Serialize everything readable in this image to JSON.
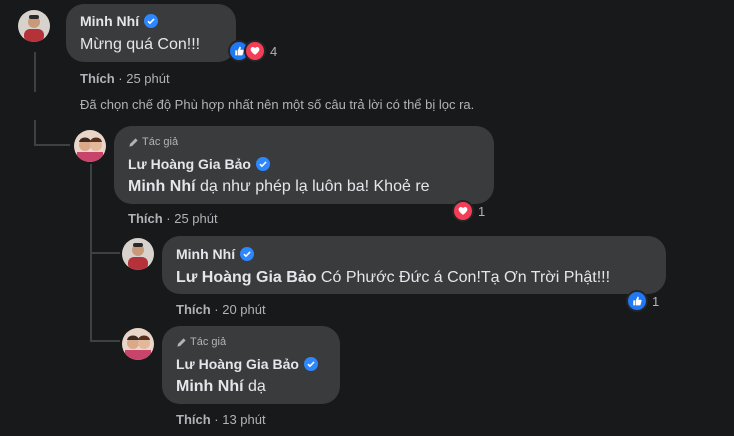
{
  "notice": "Đã chọn chế độ Phù hợp nhất nên một số câu trả lời có thể bị lọc ra.",
  "comments": [
    {
      "author": "Minh Nhí",
      "text": "Mừng quá Con!!!",
      "like_label": "Thích",
      "time": "· 25 phút",
      "reactions": [
        "like",
        "love"
      ],
      "reaction_count": "4"
    },
    {
      "badge": "Tác giả",
      "author": "Lư Hoàng Gia Bảo",
      "mention": "Minh Nhí",
      "text": " dạ như phép lạ luôn ba! Khoẻ re",
      "like_label": "Thích",
      "time": "· 25 phút",
      "reactions": [
        "love"
      ],
      "reaction_count": "1"
    },
    {
      "author": "Minh Nhí",
      "mention": "Lư Hoàng Gia Bảo",
      "text": " Có Phước Đức á Con!Tạ Ơn Trời Phật!!!",
      "like_label": "Thích",
      "time": "· 20 phút",
      "reactions": [
        "like"
      ],
      "reaction_count": "1"
    },
    {
      "badge": "Tác giả",
      "author": "Lư Hoàng Gia Bảo",
      "mention": "Minh Nhí",
      "text": " dạ",
      "like_label": "Thích",
      "time": "· 13 phút"
    }
  ],
  "colors": {
    "background": "#18191a",
    "bubble": "#3a3b3c",
    "verified": "#2d88ff",
    "like": "#2078f4",
    "love": "#f33e58"
  }
}
